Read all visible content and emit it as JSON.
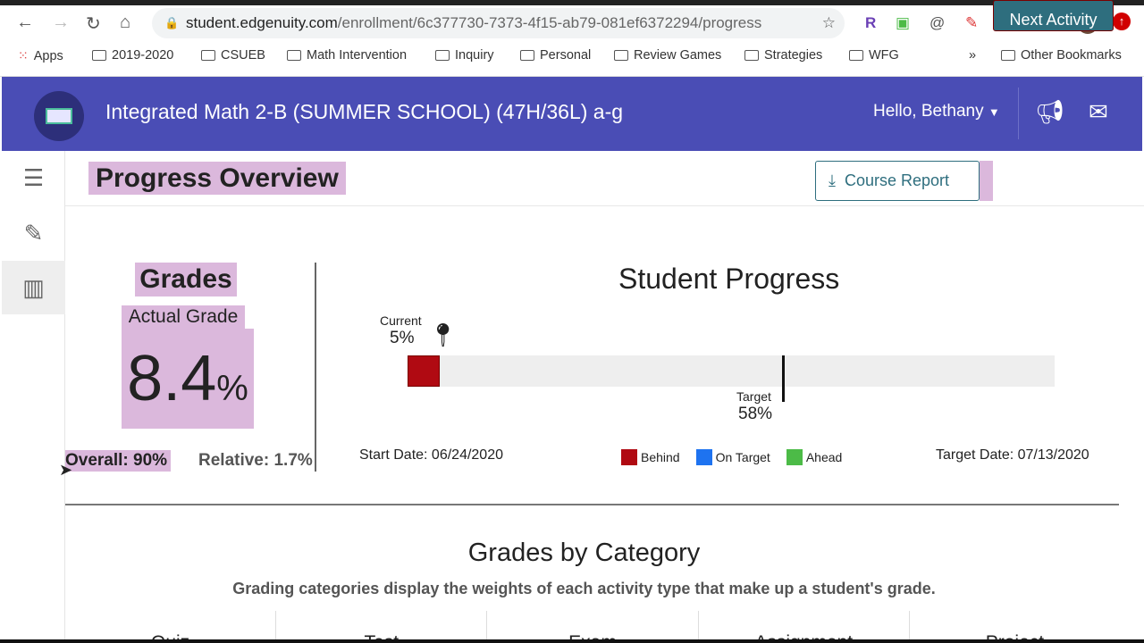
{
  "browser": {
    "url_host": "student.edgenuity.com",
    "url_path": "/enrollment/6c377730-7373-4f15-ab79-081ef6372294/progress",
    "bookmarks": [
      "Apps",
      "2019-2020",
      "CSUEB",
      "Math Intervention",
      "Inquiry",
      "Personal",
      "Review Games",
      "Strategies",
      "WFG"
    ],
    "other_bookmarks": "Other Bookmarks",
    "overflow": "»"
  },
  "header": {
    "course_title": "Integrated Math 2-B (SUMMER SCHOOL) (47H/36L) a-g",
    "greeting": "Hello, Bethany"
  },
  "page": {
    "title": "Progress Overview",
    "course_report": "Course Report",
    "next_activity": "Next Activity"
  },
  "grades": {
    "title": "Grades",
    "actual_label": "Actual Grade",
    "actual_value": "8.4",
    "actual_unit": "%",
    "overall": "Overall: 90%",
    "relative": "Relative: 1.7%"
  },
  "progress": {
    "title": "Student Progress",
    "current_label": "Current",
    "current_value": "5%",
    "current_fraction": 0.05,
    "target_label": "Target",
    "target_value": "58%",
    "target_fraction": 0.58,
    "start_date": "Start Date: 06/24/2020",
    "target_date": "Target Date: 07/13/2020",
    "legend": [
      {
        "label": "Behind",
        "color": "#b00a12"
      },
      {
        "label": "On Target",
        "color": "#1e73f0"
      },
      {
        "label": "Ahead",
        "color": "#4cbb47"
      }
    ],
    "status_color": "#b00a12"
  },
  "categories": {
    "title": "Grades by Category",
    "subtitle": "Grading categories display the weights of each activity type that make up a student's grade.",
    "columns": [
      "Quiz",
      "Test",
      "Exam",
      "Assignment",
      "Project"
    ]
  },
  "colors": {
    "header": "#4a4db5",
    "accent": "#2e6e7e",
    "highlight": "#dbb8dc"
  }
}
